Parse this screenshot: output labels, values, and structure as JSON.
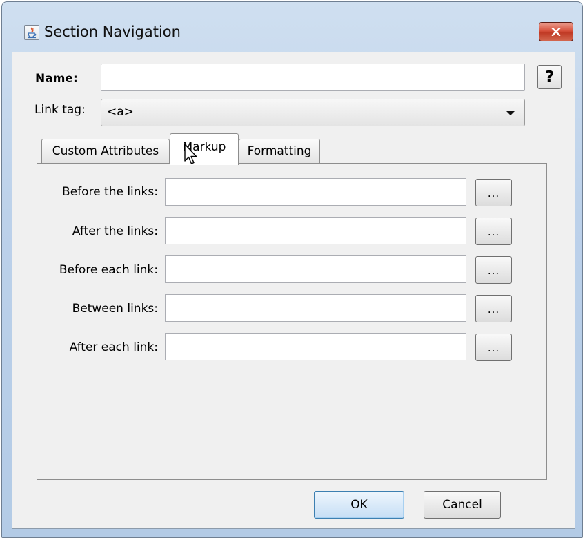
{
  "window": {
    "title": "Section Navigation",
    "close_glyph": "✕"
  },
  "form": {
    "name_label": "Name:",
    "name_value": "",
    "help_label": "?",
    "link_tag_label": "Link tag:",
    "link_tag_value": "<a>"
  },
  "tabs": [
    {
      "label": "Custom Attributes",
      "active": false
    },
    {
      "label": "Markup",
      "active": true
    },
    {
      "label": "Formatting",
      "active": false
    }
  ],
  "markup_fields": [
    {
      "label": "Before the links:",
      "value": "",
      "button_label": "..."
    },
    {
      "label": "After the links:",
      "value": "",
      "button_label": "..."
    },
    {
      "label": "Before each link:",
      "value": "",
      "button_label": "..."
    },
    {
      "label": "Between links:",
      "value": "",
      "button_label": "..."
    },
    {
      "label": "After each link:",
      "value": "",
      "button_label": "..."
    }
  ],
  "buttons": {
    "ok": "OK",
    "cancel": "Cancel"
  },
  "colors": {
    "titlebar": "#bcd1ea",
    "close_button": "#c03a25",
    "ok_border": "#3c7fb1",
    "panel_bg": "#f0f0f0"
  },
  "icons": {
    "app": "java-cup-icon",
    "close": "close-icon",
    "dropdown": "chevron-down-icon",
    "cursor": "mouse-pointer-icon"
  }
}
